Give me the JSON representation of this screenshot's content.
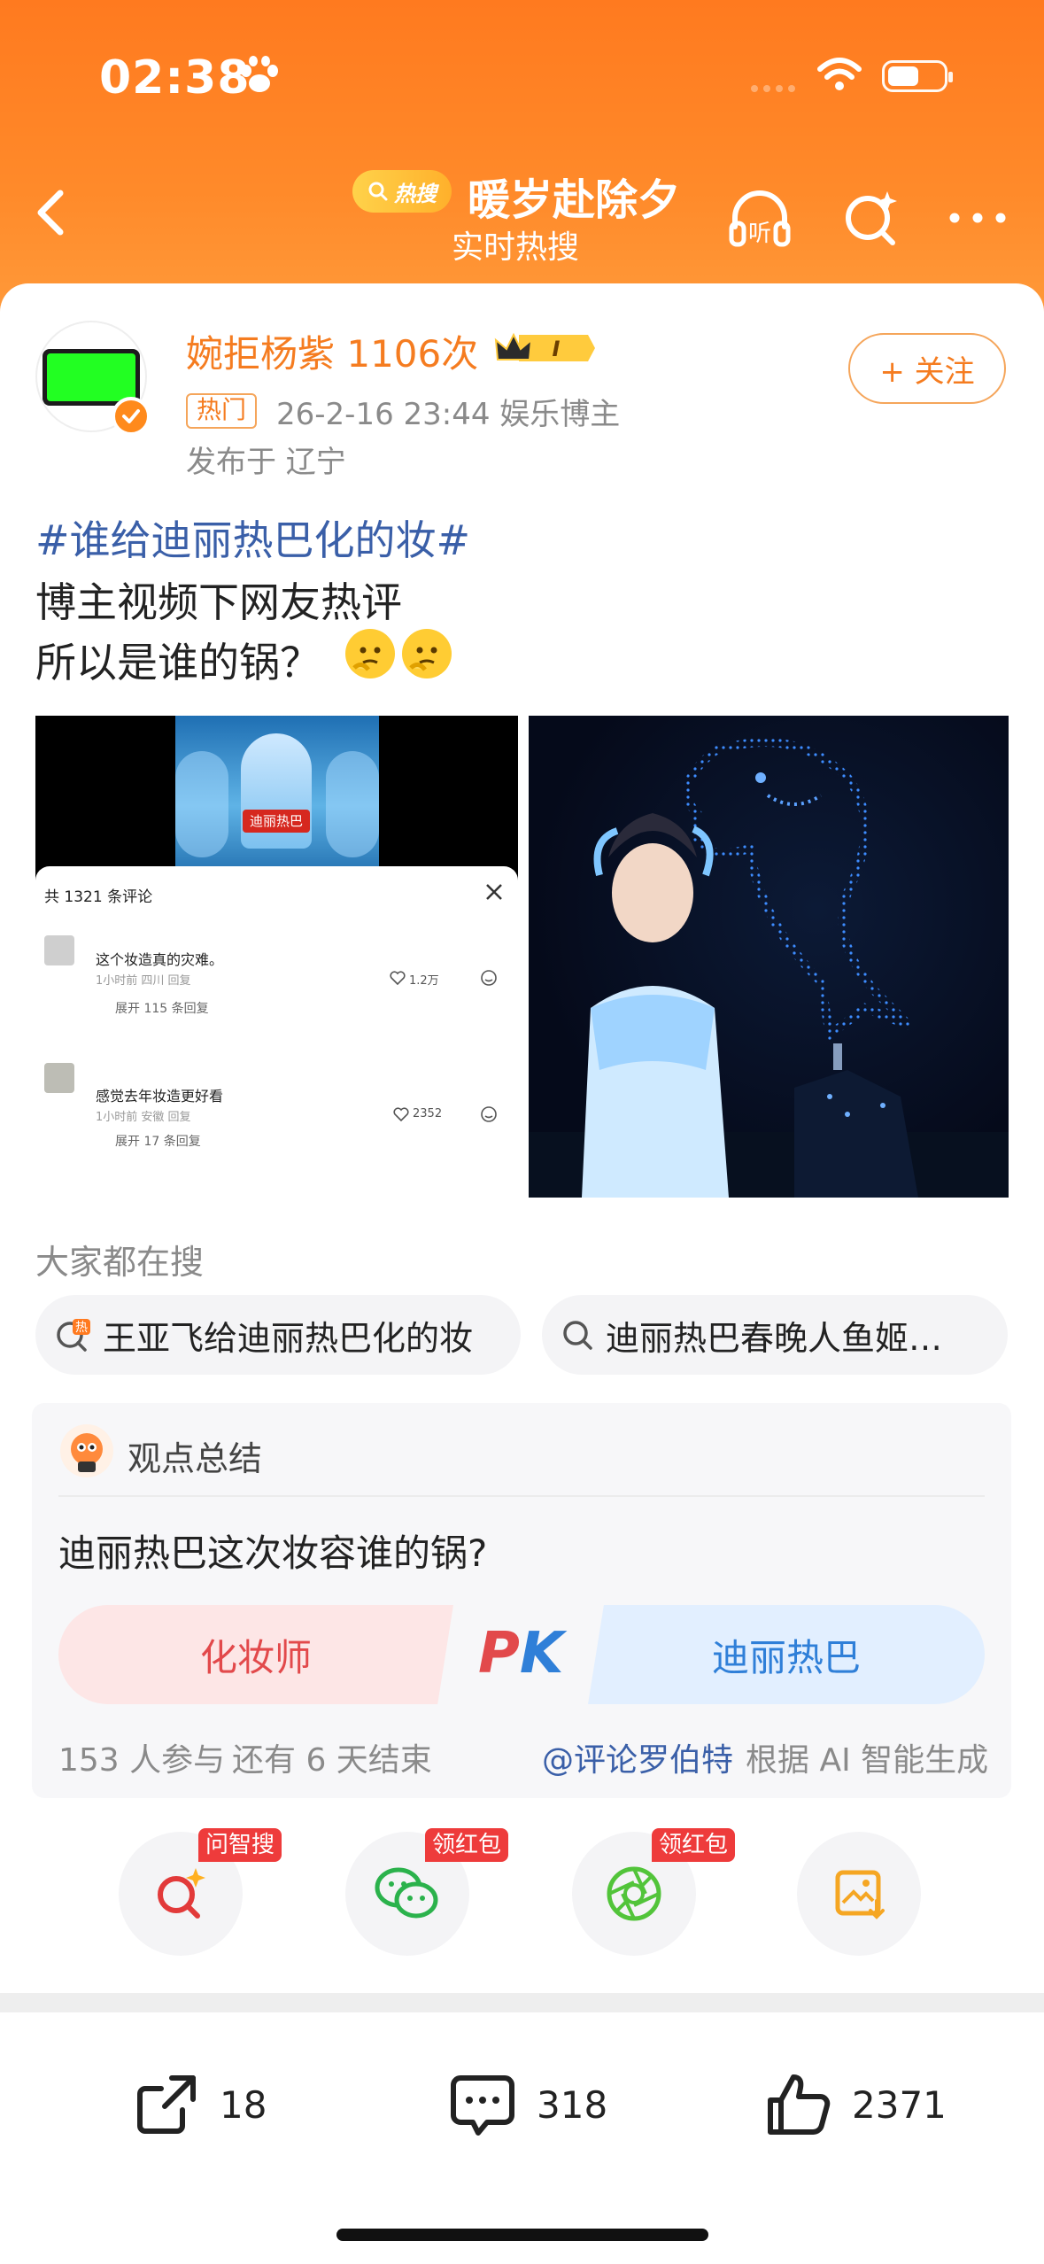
{
  "status_bar": {
    "time": "02:38"
  },
  "header": {
    "hot_badge": "热搜",
    "topic_title": "暖岁赴除夕",
    "topic_subtitle": "实时热搜",
    "listen_label": "听"
  },
  "post": {
    "username": "婉拒杨紫 1106次",
    "vip_level": "I",
    "tag": "热门",
    "meta": "26-2-16 23:44  娱乐博主",
    "location": "发布于 辽宁",
    "follow_label": "+ 关注",
    "hashtag": "#谁给迪丽热巴化的妆#",
    "text_line1": "博主视频下网友热评",
    "text_line2": "所以是谁的锅？",
    "image1": {
      "stage_caption": "迪丽热巴",
      "comments_header": "共 1321 条评论",
      "comments": [
        {
          "text": "这个妆造真的灾难。",
          "meta": "1小时前 四川  回复",
          "likes": "1.2万",
          "replies": "展开 115 条回复"
        },
        {
          "text": "感觉去年妆造更好看",
          "meta": "1小时前 安徽  回复",
          "likes": "2352",
          "replies": "展开 17 条回复"
        }
      ]
    }
  },
  "searches": {
    "title": "大家都在搜",
    "items": [
      {
        "label": "王亚飞给迪丽热巴化的妆",
        "icon": "hot-search-icon"
      },
      {
        "label": "迪丽热巴春晚人鱼姬…",
        "icon": "search-icon"
      }
    ]
  },
  "summary": {
    "title": "观点总结",
    "question": "迪丽热巴这次妆容谁的锅?",
    "option_left": "化妆师",
    "pk_label": "PK",
    "option_right": "迪丽热巴",
    "participants": "153 人参与",
    "remaining": "还有 6 天结束",
    "credit_author": "@评论罗伯特",
    "credit_note": "根据 AI 智能生成"
  },
  "actions": [
    {
      "name": "ask-search",
      "badge": "问智搜",
      "icon": "ai-search-icon"
    },
    {
      "name": "wechat-share",
      "badge": "领红包",
      "icon": "wechat-icon"
    },
    {
      "name": "moments-share",
      "badge": "领红包",
      "icon": "moments-icon"
    },
    {
      "name": "save-image",
      "badge": "",
      "icon": "save-image-icon"
    }
  ],
  "bottom_bar": {
    "share_count": "18",
    "comment_count": "318",
    "like_count": "2371"
  },
  "colors": {
    "brand_orange": "#ff7a1f",
    "link_blue": "#3a5fa8",
    "pk_red": "#e2494b",
    "pk_blue": "#2f7fd8"
  }
}
